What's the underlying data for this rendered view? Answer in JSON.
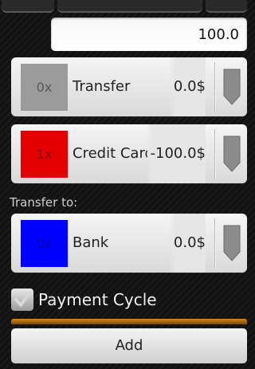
{
  "amount_field": {
    "value": "100.0"
  },
  "accounts": [
    {
      "index_label": "0x",
      "name": "Transfer",
      "balance": "0.0$",
      "swatch_color": "#9b9b9b",
      "label_color": "#5a5a5a"
    },
    {
      "index_label": "1x",
      "name": "Credit Card",
      "balance": "-100.0$",
      "swatch_color": "#e30000",
      "label_color": "#7a0000"
    },
    {
      "index_label": "0x",
      "name": "Bank",
      "balance": "0.0$",
      "swatch_color": "#0000ff",
      "label_color": "#0000a0"
    }
  ],
  "transfer_to_label": "Transfer to:",
  "payment_cycle": {
    "label": "Payment Cycle",
    "checked": true
  },
  "add_button": {
    "label": "Add"
  }
}
